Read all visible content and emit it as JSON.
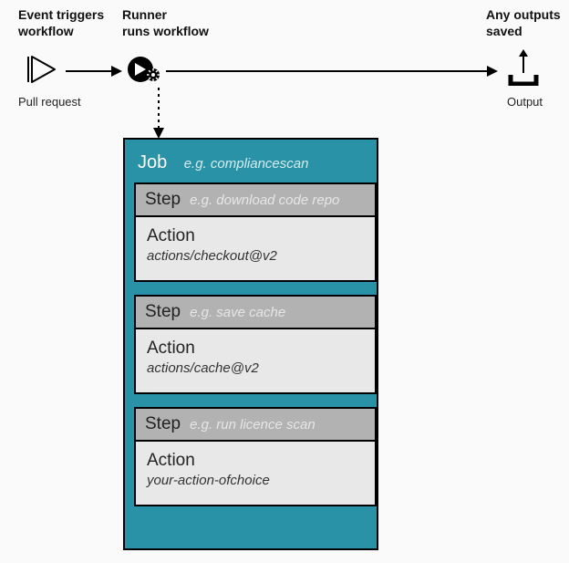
{
  "headers": {
    "event": {
      "line1": "Event triggers",
      "line2": "workflow"
    },
    "runner": {
      "line1": "Runner",
      "line2": "runs workflow"
    },
    "output": {
      "line1": "Any outputs",
      "line2": "saved"
    }
  },
  "labels": {
    "pull_request": "Pull request",
    "output": "Output"
  },
  "job": {
    "title": "Job",
    "example": "e.g. compliancescan",
    "steps": [
      {
        "step_label": "Step",
        "step_example": "e.g. download code repo",
        "action_label": "Action",
        "action_ref": "actions/checkout@v2"
      },
      {
        "step_label": "Step",
        "step_example": "e.g. save cache",
        "action_label": "Action",
        "action_ref": "actions/cache@v2"
      },
      {
        "step_label": "Step",
        "step_example": "e.g. run licence scan",
        "action_label": "Action",
        "action_ref": "your-action-ofchoice"
      }
    ]
  }
}
